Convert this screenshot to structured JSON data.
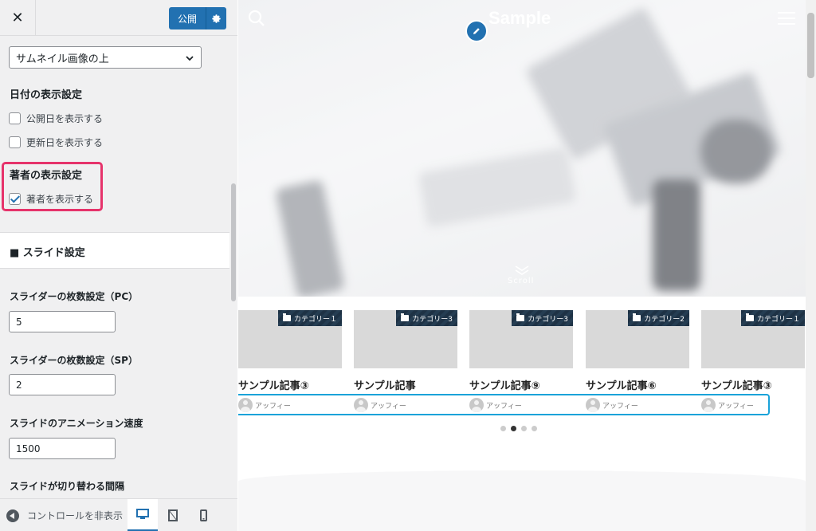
{
  "header": {
    "close_label": "✕",
    "publish_label": "公開"
  },
  "panel": {
    "thumbnail_select_value": "サムネイル画像の上",
    "date_section_title": "日付の表示設定",
    "show_published_label": "公開日を表示する",
    "show_published_checked": false,
    "show_updated_label": "更新日を表示する",
    "show_updated_checked": false,
    "author_section_title": "著者の表示設定",
    "show_author_label": "著者を表示する",
    "show_author_checked": true,
    "slide_section_label": "■ スライド設定",
    "slider_count_pc_label": "スライダーの枚数設定（PC）",
    "slider_count_pc_value": "5",
    "slider_count_sp_label": "スライダーの枚数設定（SP）",
    "slider_count_sp_value": "2",
    "slide_speed_label": "スライドのアニメーション速度",
    "slide_speed_value": "1500",
    "slide_interval_label": "スライドが切り替わる間隔"
  },
  "footer": {
    "collapse_label": "コントロールを非表示"
  },
  "preview": {
    "site_title": "Sample",
    "scroll_label": "Scroll",
    "cards": [
      {
        "category": "カテゴリー１",
        "title": "サンプル記事③",
        "author": "アッフィー"
      },
      {
        "category": "カテゴリー3",
        "title": "サンプル記事",
        "author": "アッフィー"
      },
      {
        "category": "カテゴリー3",
        "title": "サンプル記事⑨",
        "author": "アッフィー"
      },
      {
        "category": "カテゴリー2",
        "title": "サンプル記事⑥",
        "author": "アッフィー"
      },
      {
        "category": "カテゴリー１",
        "title": "サンプル記事③",
        "author": "アッフィー"
      }
    ],
    "slider_dots": 4,
    "active_dot": 1
  },
  "colors": {
    "accent": "#2271b1",
    "highlight_pink": "#e6336b",
    "highlight_blue": "#1aa3d9",
    "category_badge": "#1e3245"
  }
}
